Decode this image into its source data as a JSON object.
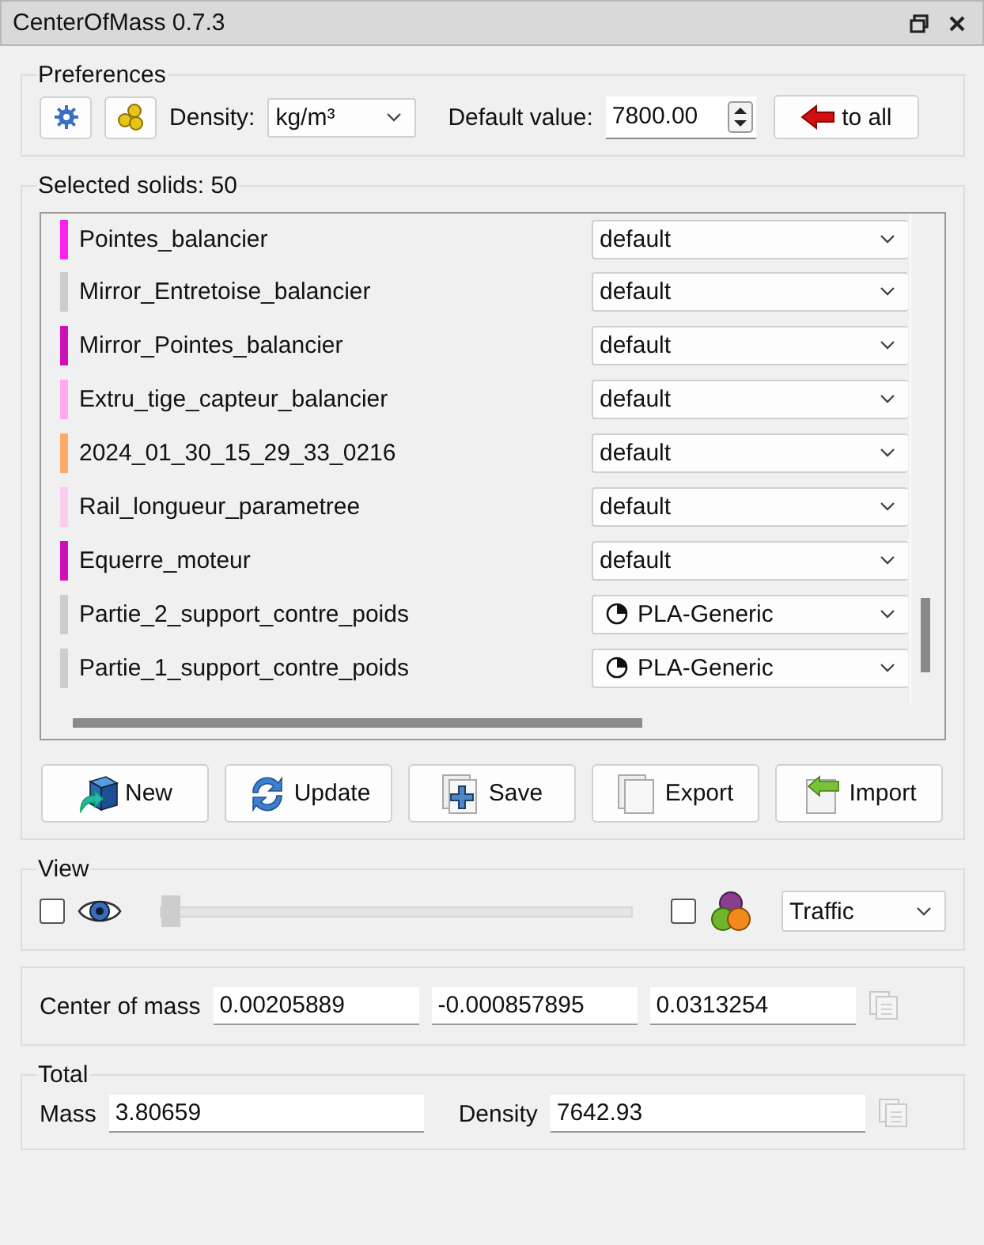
{
  "window": {
    "title": "CenterOfMass 0.7.3"
  },
  "preferences": {
    "title": "Preferences",
    "density_label": "Density:",
    "density_unit": "kg/m³",
    "default_label": "Default value:",
    "default_value": "7800.00",
    "apply_button": "to all"
  },
  "solids": {
    "title": "Selected solids: 50",
    "rows": [
      {
        "name": "Pointes_balancier",
        "color": "#ff22ee",
        "material": "default",
        "kind": "plain"
      },
      {
        "name": "Mirror_Entretoise_balancier",
        "color": "#cccccc",
        "material": "default",
        "kind": "plain"
      },
      {
        "name": "Mirror_Pointes_balancier",
        "color": "#cc11bb",
        "material": "default",
        "kind": "plain"
      },
      {
        "name": "Extru_tige_capteur_balancier",
        "color": "#ffaaee",
        "material": "default",
        "kind": "plain"
      },
      {
        "name": "2024_01_30_15_29_33_0216",
        "color": "#ffaa66",
        "material": "default",
        "kind": "plain"
      },
      {
        "name": "Rail_longueur_parametree",
        "color": "#ffccee",
        "material": "default",
        "kind": "plain"
      },
      {
        "name": "Equerre_moteur",
        "color": "#cc11bb",
        "material": "default",
        "kind": "plain"
      },
      {
        "name": "Partie_2_support_contre_poids",
        "color": "#cccccc",
        "material": "PLA-Generic",
        "kind": "pie"
      },
      {
        "name": "Partie_1_support_contre_poids",
        "color": "#cccccc",
        "material": "PLA-Generic",
        "kind": "pie"
      }
    ],
    "buttons": [
      {
        "label": "New",
        "kind": "new"
      },
      {
        "label": "Update",
        "kind": "update"
      },
      {
        "label": "Save",
        "kind": "save"
      },
      {
        "label": "Export",
        "kind": "export"
      },
      {
        "label": "Import",
        "kind": "import"
      }
    ]
  },
  "view": {
    "title": "View",
    "show_checked": false,
    "level": 0,
    "color_checked": false,
    "scheme": "Traffic"
  },
  "center": {
    "label": "Center of mass",
    "values": [
      "0.00205889",
      "-0.000857895",
      "0.0313254"
    ]
  },
  "total": {
    "title": "Total",
    "mass_label": "Mass",
    "mass": "3.80659",
    "density_label": "Density",
    "density": "7642.93"
  }
}
